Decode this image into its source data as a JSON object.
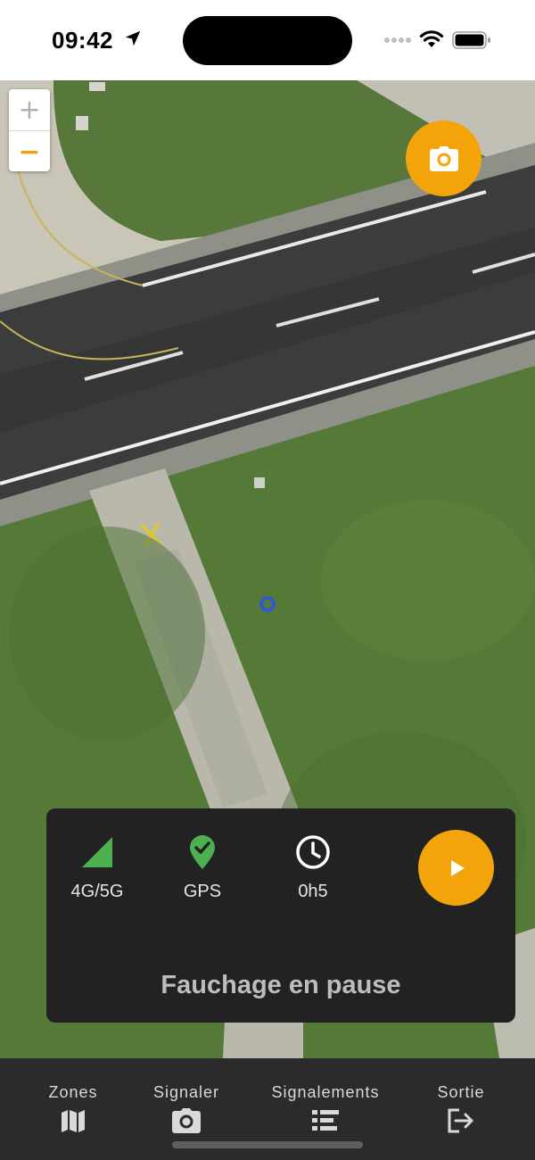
{
  "status_bar": {
    "time": "09:42",
    "icons": [
      "location-arrow-icon",
      "signal-dots-icon",
      "wifi-icon",
      "battery-icon"
    ]
  },
  "map": {
    "zoom_in_label": "+",
    "zoom_out_label": "−",
    "camera_button_icon": "camera-icon",
    "user_location_icon": "location-dot-icon"
  },
  "panel": {
    "network": {
      "label": "4G/5G",
      "icon": "signal-strength-icon",
      "color": "#4caf50"
    },
    "gps": {
      "label": "GPS",
      "icon": "gps-check-icon",
      "color": "#4caf50"
    },
    "timer": {
      "label": "0h5",
      "icon": "clock-icon"
    },
    "play_icon": "play-icon",
    "status_text": "Fauchage en pause"
  },
  "nav": {
    "zones": "Zones",
    "signaler": "Signaler",
    "signalements": "Signalements",
    "sortie": "Sortie"
  },
  "colors": {
    "accent": "#f3a40b",
    "panel_bg": "#222222",
    "nav_bg": "#2b2b2b",
    "ok_green": "#4caf50"
  }
}
